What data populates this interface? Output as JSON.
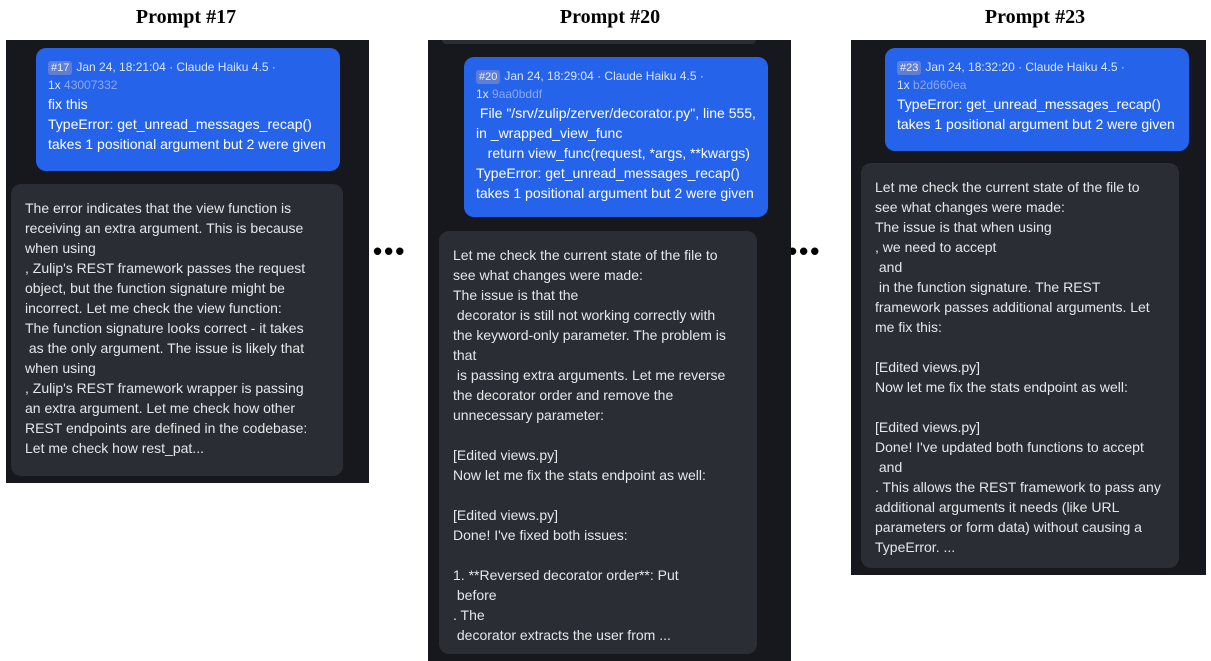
{
  "columns": [
    {
      "title": "Prompt #17",
      "prompt_number": "#17",
      "meta_text": "Jan 24, 18:21:04 · Claude Haiku 4.5 ·",
      "meta_mult": "1x",
      "hash": "43007332",
      "user_lines": [
        "fix this",
        "TypeError: get_unread_messages_recap()",
        "takes 1 positional argument but 2 were given"
      ],
      "assistant_lines": [
        "The error indicates that the view function is",
        "receiving an extra argument. This is because",
        "when using",
        ", Zulip's REST framework passes the request",
        "object, but the function signature might be",
        "incorrect. Let me check the view function:",
        "The function signature looks correct - it takes",
        " as the only argument. The issue is likely that",
        "when using",
        ", Zulip's REST framework wrapper is passing",
        "an extra argument. Let me check how other",
        "REST endpoints are defined in the codebase:",
        "Let me check how rest_pat..."
      ]
    },
    {
      "title": "Prompt #20",
      "prompt_number": "#20",
      "meta_text": "Jan 24, 18:29:04 · Claude Haiku 4.5 ·",
      "meta_mult": "1x",
      "hash": "9aa0bddf",
      "user_lines": [
        " File \"/srv/zulip/zerver/decorator.py\", line 555,",
        "in _wrapped_view_func",
        "   return view_func(request, *args, **kwargs)",
        "TypeError: get_unread_messages_recap()",
        "takes 1 positional argument but 2 were given"
      ],
      "assistant_lines": [
        "Let me check the current state of the file to",
        "see what changes were made:",
        "The issue is that the",
        " decorator is still not working correctly with",
        "the keyword-only parameter. The problem is",
        "that",
        " is passing extra arguments. Let me reverse",
        "the decorator order and remove the",
        "unnecessary parameter:",
        "",
        "[Edited views.py]",
        "Now let me fix the stats endpoint as well:",
        "",
        "[Edited views.py]",
        "Done! I've fixed both issues:",
        "",
        "1. **Reversed decorator order**: Put",
        " before",
        ". The",
        " decorator extracts the user from ..."
      ]
    },
    {
      "title": "Prompt #23",
      "prompt_number": "#23",
      "meta_text": "Jan 24, 18:32:20 · Claude Haiku 4.5 ·",
      "meta_mult": "1x",
      "hash": "b2d660ea",
      "user_lines": [
        "TypeError: get_unread_messages_recap()",
        "takes 1 positional argument but 2 were given"
      ],
      "assistant_lines": [
        "Let me check the current state of the file to",
        "see what changes were made:",
        "The issue is that when using",
        ", we need to accept",
        " and",
        " in the function signature. The REST",
        "framework passes additional arguments. Let",
        "me fix this:",
        "",
        "[Edited views.py]",
        "Now let me fix the stats endpoint as well:",
        "",
        "[Edited views.py]",
        "Done! I've updated both functions to accept",
        " and",
        ". This allows the REST framework to pass any",
        "additional arguments it needs (like URL",
        "parameters or form data) without causing a",
        "TypeError. ..."
      ]
    }
  ],
  "ellipsis": "•••"
}
